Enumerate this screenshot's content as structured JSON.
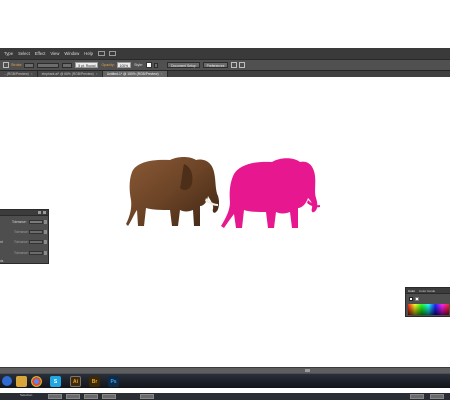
{
  "menubar": {
    "items": [
      "Type",
      "Select",
      "Effect",
      "View",
      "Window",
      "Help"
    ]
  },
  "control_bar": {
    "stroke_label": "Stroke:",
    "stroke_icon": "stroke-weight-dropdown",
    "brush_label": "5 pt. Round",
    "opacity_label": "Opacity:",
    "opacity_value": "100%",
    "style_label": "Style:",
    "document_setup": "Document Setup",
    "preferences": "Preferences"
  },
  "tabs": [
    {
      "label": "...(RGB/Preview)",
      "active": false
    },
    {
      "label": "elephant.ai* @ 66% (RGB/Preview)",
      "active": false
    },
    {
      "label": "Untitled-1* @ 150% (RGB/Preview)",
      "active": true
    }
  ],
  "tab_close_glyph": "×",
  "left_panel": {
    "side_labels": [
      "nt",
      "ds"
    ],
    "rows": [
      {
        "label": "Tolerance:",
        "value": ""
      },
      {
        "label": "Tolerance:",
        "value": ""
      },
      {
        "label": "Tolerance:",
        "value": ""
      },
      {
        "label": "Tolerance:",
        "value": ""
      }
    ]
  },
  "color_panel": {
    "tabs": [
      "Color",
      "Color Guide"
    ]
  },
  "taskbar": {
    "icons": [
      "windows-explorer-icon",
      "chrome-icon",
      "skype-icon",
      "illustrator-icon",
      "bridge-icon",
      "photoshop-icon"
    ],
    "letters": {
      "illustrator": "Ai",
      "bridge": "Br",
      "photoshop": "Ps",
      "skype": "S"
    }
  },
  "bottom_strip": {
    "label": "Selection"
  },
  "colors": {
    "elephant_fill": "#e6178f",
    "elephant_photo": "#6b4326",
    "ui_dark": "#3a3a3a",
    "ui_panel": "#4e4e4e",
    "accent_label": "#e0a34a"
  }
}
